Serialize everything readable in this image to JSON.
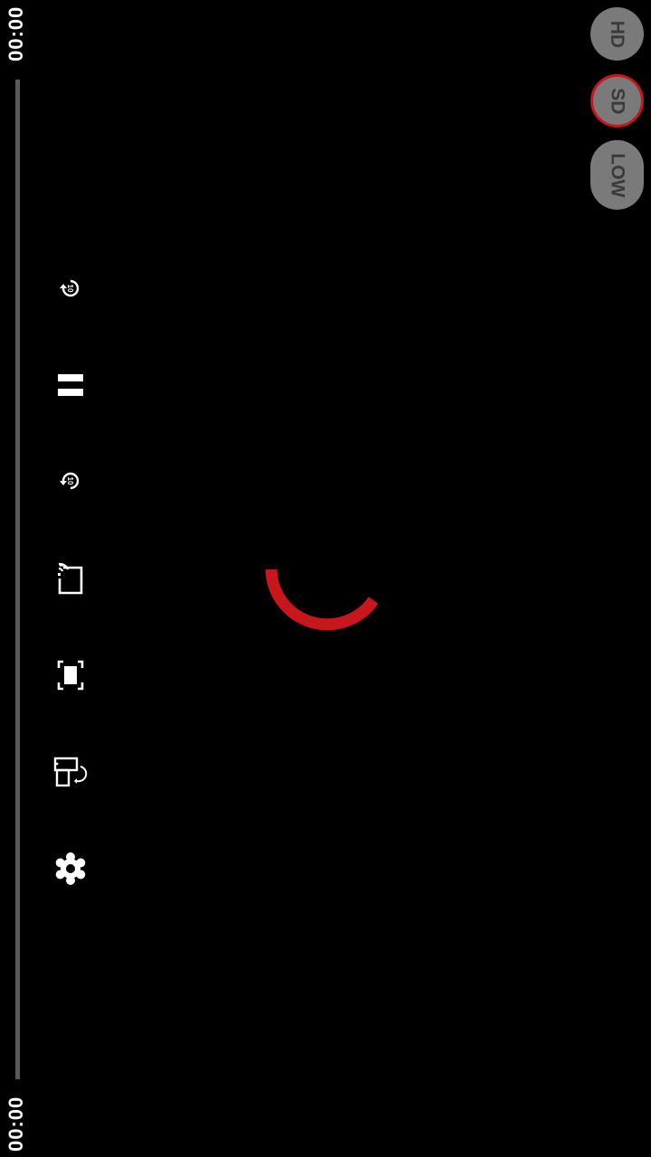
{
  "player": {
    "current_time": "00:00",
    "total_time": "00:00",
    "progress": 0
  },
  "quality": {
    "options": [
      "HD",
      "SD",
      "LOW"
    ],
    "selected": "SD"
  },
  "controls": [
    {
      "name": "rewind-10-icon",
      "label": "10"
    },
    {
      "name": "pause-icon"
    },
    {
      "name": "forward-10-icon",
      "label": "10"
    },
    {
      "name": "cast-icon"
    },
    {
      "name": "fullscreen-icon"
    },
    {
      "name": "rotate-screen-icon"
    },
    {
      "name": "settings-gear-icon"
    }
  ],
  "colors": {
    "accent": "#c8161d",
    "background": "#000000",
    "icon": "#ffffff",
    "pill": "#7a7a7a",
    "track": "#5a5a5a"
  }
}
